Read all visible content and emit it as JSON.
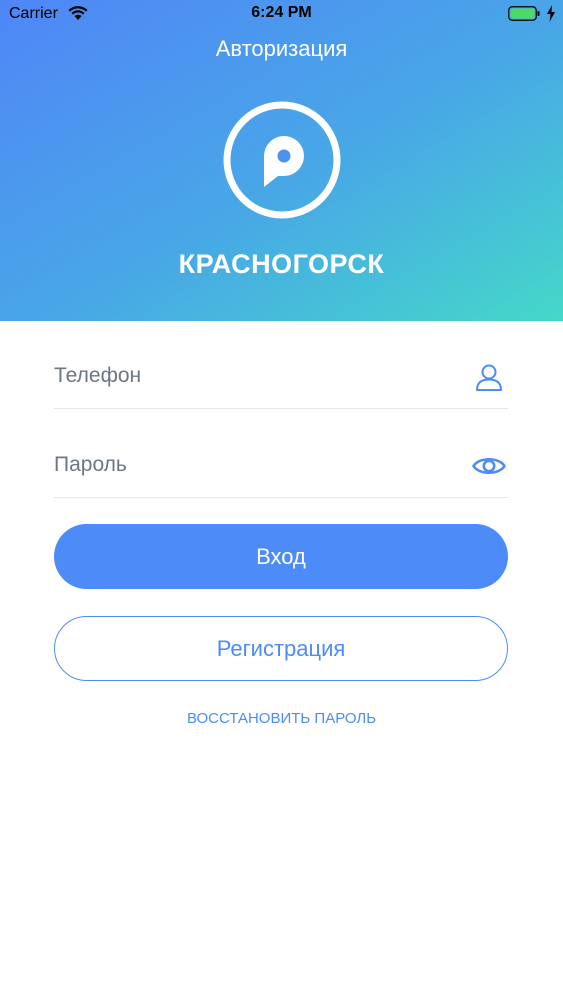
{
  "status_bar": {
    "carrier": "Carrier",
    "time": "6:24 PM",
    "wifi_icon": "wifi-icon",
    "battery_icon": "battery-icon",
    "charging_icon": "charging-bolt-icon"
  },
  "header": {
    "title": "Авторизация",
    "logo_icon": "parking-pin-logo-icon",
    "city": "КРАСНОГОРСК"
  },
  "form": {
    "phone": {
      "placeholder": "Телефон",
      "value": "",
      "icon": "user-icon"
    },
    "password": {
      "placeholder": "Пароль",
      "value": "",
      "icon": "eye-icon"
    }
  },
  "buttons": {
    "login_label": "Вход",
    "register_label": "Регистрация",
    "restore_label": "ВОССТАНОВИТЬ ПАРОЛЬ"
  },
  "colors": {
    "accent": "#4d8cf8",
    "gradient_start": "#4f86f7",
    "gradient_end": "#45d8c9"
  }
}
